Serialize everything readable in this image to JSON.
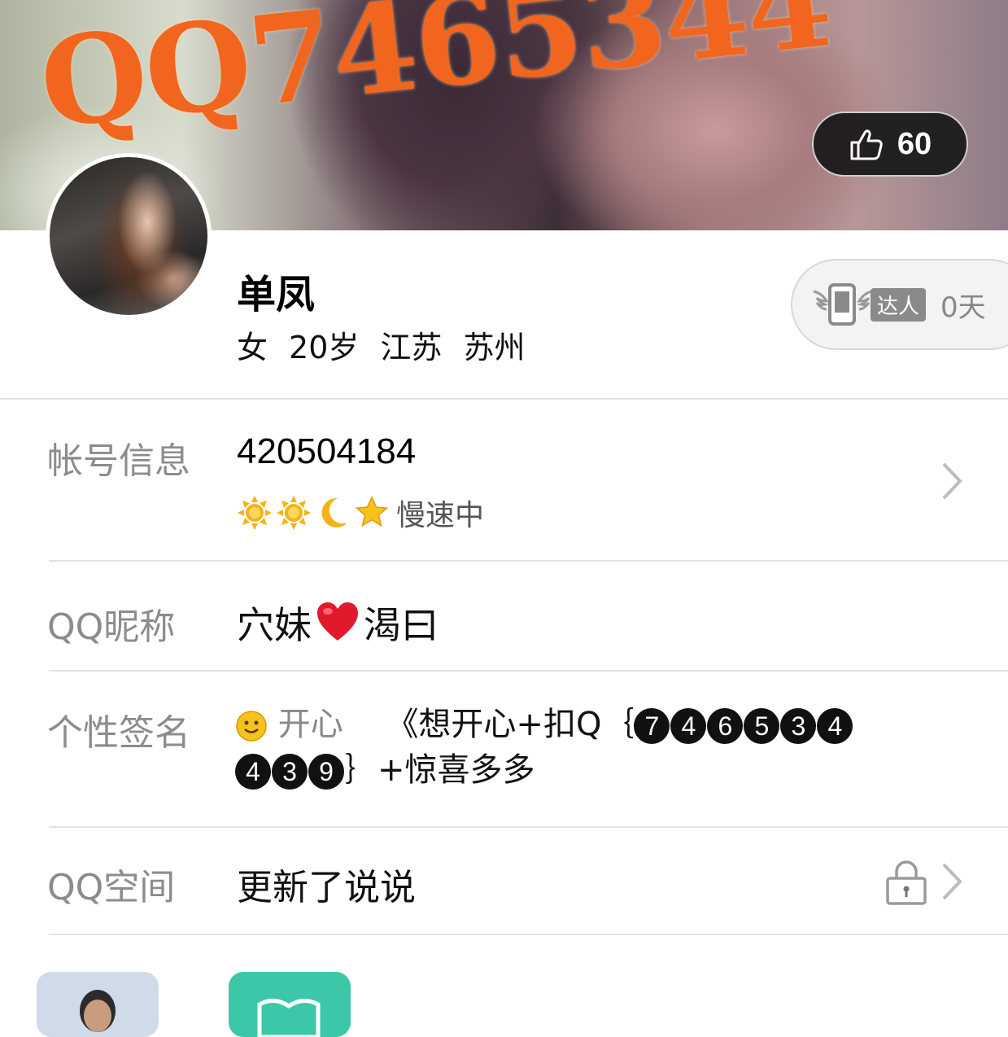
{
  "cover": {
    "banner_text": "QQ7465344",
    "like_count": "60",
    "like_icon": "thumbs-up-icon"
  },
  "profile": {
    "name": "单凤",
    "gender": "女",
    "age": "20岁",
    "province": "江苏",
    "city": "苏州",
    "daren_tag": "达人",
    "daren_days": "0天",
    "daren_icon": "winged-phone-icon"
  },
  "rows": {
    "account": {
      "label": "帐号信息",
      "number": "420504184",
      "level_icons": [
        "sun-icon",
        "sun-icon",
        "moon-icon",
        "star-icon"
      ],
      "level_status": "慢速中"
    },
    "nickname": {
      "label": "QQ昵称",
      "part1": "穴妹",
      "heart": "❤️",
      "part2": "渴曰"
    },
    "signature": {
      "label": "个性签名",
      "mood_icon": "smiley-icon",
      "mood_text": "开心",
      "text_before": "《想开心+扣Q｛",
      "circled_digits": [
        "7",
        "4",
        "6",
        "5",
        "3",
        "4",
        "4",
        "3",
        "9"
      ],
      "text_after": "｝+惊喜多多"
    },
    "qzone": {
      "label": "QQ空间",
      "value": "更新了说说"
    }
  },
  "colors": {
    "banner_orange": "#f2651f",
    "label_gray": "#8c8c8c",
    "tile_green": "#3cc8a8",
    "tile_blue": "#cfdbe8"
  }
}
